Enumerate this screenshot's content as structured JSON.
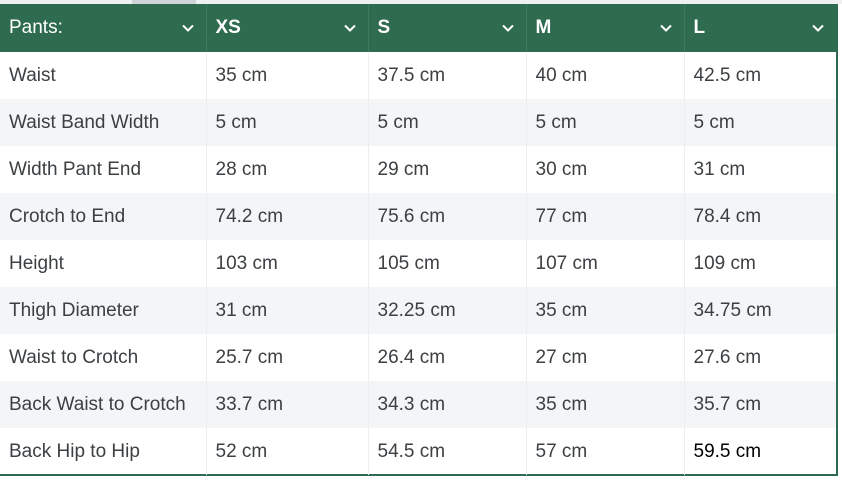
{
  "header": {
    "columns": [
      {
        "label": "Pants:"
      },
      {
        "label": "XS"
      },
      {
        "label": "S"
      },
      {
        "label": "M"
      },
      {
        "label": "L"
      }
    ]
  },
  "rows": [
    {
      "label": "Waist",
      "xs": "35 cm",
      "s": "37.5 cm",
      "m": "40 cm",
      "l": "42.5 cm"
    },
    {
      "label": "Waist Band Width",
      "xs": "5 cm",
      "s": "5 cm",
      "m": "5 cm",
      "l": "5 cm"
    },
    {
      "label": "Width Pant End",
      "xs": "28 cm",
      "s": "29 cm",
      "m": "30 cm",
      "l": "31 cm"
    },
    {
      "label": "Crotch to End",
      "xs": "74.2 cm",
      "s": "75.6 cm",
      "m": "77 cm",
      "l": "78.4 cm"
    },
    {
      "label": "Height",
      "xs": "103 cm",
      "s": "105 cm",
      "m": "107 cm",
      "l": "109 cm"
    },
    {
      "label": "Thigh Diameter",
      "xs": "31 cm",
      "s": "32.25 cm",
      "m": "35 cm",
      "l": "34.75 cm"
    },
    {
      "label": "Waist to Crotch",
      "xs": "25.7 cm",
      "s": "26.4 cm",
      "m": "27 cm",
      "l": "27.6 cm"
    },
    {
      "label": "Back Waist to Crotch",
      "xs": "33.7 cm",
      "s": "34.3 cm",
      "m": "35 cm",
      "l": "35.7 cm"
    },
    {
      "label": "Back Hip to Hip",
      "xs": "52 cm",
      "s": "54.5 cm",
      "m": "57 cm",
      "l": "59.5 cm"
    }
  ],
  "icons": {
    "header_dropdown": "chevron-down-icon"
  },
  "colors": {
    "header_bg": "#2f6b4f",
    "header_text": "#ffffff",
    "border": "#2d6a4f"
  }
}
